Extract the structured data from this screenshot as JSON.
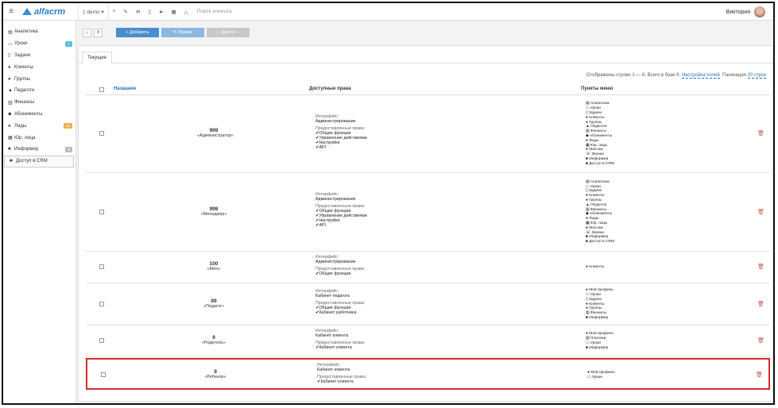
{
  "app": {
    "logo_text": "alfacrm",
    "company": "demo",
    "search_placeholder": "Поиск клиента",
    "user_name": "Виктория",
    "brand_color": "#2a7fc8"
  },
  "sidebar": [
    {
      "icon": "chart-icon",
      "glyph": "▤",
      "label": "Аналитика"
    },
    {
      "icon": "calendar-icon",
      "glyph": "▭",
      "label": "Уроки",
      "badge": "+",
      "badge_color": "#5bc0de"
    },
    {
      "icon": "clipboard-icon",
      "glyph": "▯",
      "label": "Задачи"
    },
    {
      "icon": "user-icon",
      "glyph": "●",
      "label": "Клиенты"
    },
    {
      "icon": "users-icon",
      "glyph": "●",
      "label": "Группы"
    },
    {
      "icon": "graduation-cap-icon",
      "glyph": "▲",
      "label": "Педагоги"
    },
    {
      "icon": "money-icon",
      "glyph": "▥",
      "label": "Финансы"
    },
    {
      "icon": "tag-icon",
      "glyph": "◆",
      "label": "Абонементы"
    },
    {
      "icon": "user-plus-icon",
      "glyph": "●",
      "label": "Лиды",
      "badge": "16",
      "badge_color": "#f0ad4e"
    },
    {
      "icon": "building-icon",
      "glyph": "▦",
      "label": "Юр. лица"
    },
    {
      "icon": "informer-icon",
      "glyph": "■",
      "label": "Информер",
      "badge": "0",
      "badge_color": "#bbbbbb"
    },
    {
      "icon": "lock-icon",
      "glyph": "■",
      "label": "Доступ в CRM",
      "active": true
    }
  ],
  "actions": {
    "mini1": "⌂",
    "mini2": "X",
    "add": "+ Добавить",
    "edit": "✎ Правка",
    "other": "— Другое —"
  },
  "tab_current": "Текущие",
  "table_info": {
    "text": "Отображены строки 1 — 6. Всего в базе 6.",
    "settings": "Настройка полей",
    "pagination_label": "Пагинация",
    "pagination_value": "20 строк"
  },
  "columns": {
    "name": "Название",
    "rights": "Доступные права",
    "menu": "Пункты меню"
  },
  "rows": [
    {
      "num": "999",
      "title": "«Администратор»",
      "interface_label": "Интерфейс:",
      "interface": "Администрирование",
      "granted_label": "Предоставленные права:",
      "rights": [
        "✔Общие функции",
        "✔Управление действиями",
        "✔Настройки",
        "✔API"
      ],
      "menu": [
        "▤ Аналитика",
        "▭ Уроки",
        "▯ Задачи",
        "● Клиенты",
        "● Группы",
        "▲ Педагоги",
        "▥ Финансы",
        "◆ Абонементы",
        "● Лиды",
        "▦ Юр. лица",
        "● Массаж",
        "☏ Звонки",
        "■ Информер",
        "■ Доступ в CRM"
      ]
    },
    {
      "num": "998",
      "title": "«Менеджер»",
      "interface_label": "Интерфейс:",
      "interface": "Администрирование",
      "granted_label": "Предоставленные права:",
      "rights": [
        "✔Общие функции",
        "✔Управление действиями",
        "✔Настройки",
        "✔API"
      ],
      "menu": [
        "▤ Аналитика",
        "▭ Уроки",
        "▯ Задачи",
        "● Клиенты",
        "● Группы",
        "▲ Педагоги",
        "▥ Финансы",
        "◆ Абонементы",
        "● Лиды",
        "▦ Юр. лица",
        "● Массаж",
        "☏ Звонки",
        "■ Информер",
        "■ Доступ в CRM"
      ]
    },
    {
      "num": "100",
      "title": "«Мен»",
      "interface_label": "Интерфейс:",
      "interface": "Администрирование",
      "granted_label": "Предоставленные права:",
      "rights": [
        "✔Общие функции"
      ],
      "menu": [
        "● Клиенты"
      ]
    },
    {
      "num": "99",
      "title": "«Педагог»",
      "interface_label": "Интерфейс:",
      "interface": "Кабинет педагога",
      "granted_label": "Предоставленные права:",
      "rights": [
        "✔Общие функции",
        "✔Кабинет работника"
      ],
      "menu": [
        "● Мой профиль",
        "▭ Уроки",
        "▯ Задачи",
        "● Клиенты",
        "● Группы",
        "▥ Финансы",
        "■ Информер"
      ]
    },
    {
      "num": "9",
      "title": "«Родитель»",
      "interface_label": "Интерфейс:",
      "interface": "Кабинет клиента",
      "granted_label": "Предоставленные права:",
      "rights": [
        "✔Кабинет клиента"
      ],
      "menu": [
        "● Мой профиль",
        "▥ Платежи",
        "▭ Уроки",
        "■ Информер"
      ]
    },
    {
      "num": "9",
      "title": "«Ребенок»",
      "interface_label": "Интерфейс:",
      "interface": "Кабинет клиента",
      "granted_label": "Предоставленные права:",
      "rights": [
        "✔Кабинет клиента"
      ],
      "menu": [
        "● Мой профиль",
        "▭ Уроки"
      ],
      "selected": true
    }
  ]
}
